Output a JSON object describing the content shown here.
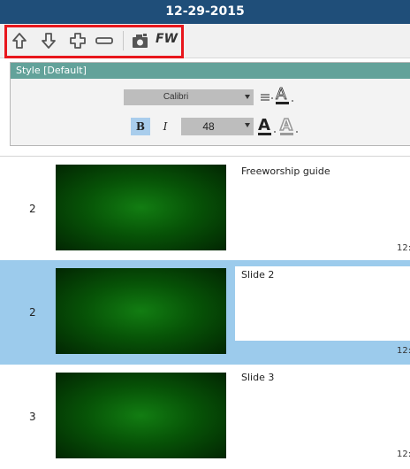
{
  "title": "12-29-2015",
  "toolbar": {
    "icons": [
      "arrow-up-icon",
      "arrow-down-icon",
      "plus-icon",
      "minus-icon",
      "camera-icon"
    ],
    "fw_label": "FW",
    "highlight_color": "#e8161c"
  },
  "style_panel": {
    "header": "Style [Default]",
    "font": "Calibri",
    "font_size": "48",
    "bold_label": "B",
    "italic_label": "I",
    "align_icon": "align-center-icon",
    "text_color_icon": "text-color-icon",
    "outline_icon": "text-outline-icon",
    "shadow_icon": "text-shadow-icon",
    "header_color": "#63a29a"
  },
  "slides": [
    {
      "number": "2",
      "label": "Freeworship guide",
      "time": "12:",
      "selected": false
    },
    {
      "number": "2",
      "label": "Slide 2",
      "time": "12:",
      "selected": true
    },
    {
      "number": "3",
      "label": "Slide 3",
      "time": "12:",
      "selected": false
    }
  ],
  "colors": {
    "title_bar": "#1f4e79",
    "selected_row": "#9ccbec",
    "thumb": "#0a5e0a"
  }
}
